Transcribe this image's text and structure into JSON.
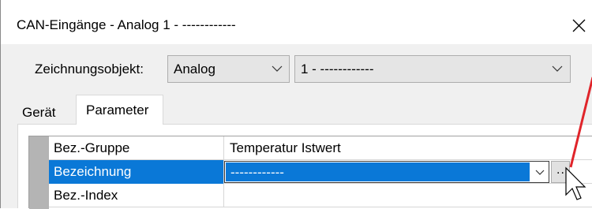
{
  "window": {
    "title": "CAN-Eingänge - Analog 1 - ------------",
    "close_glyph": "✕"
  },
  "drawing_object": {
    "label": "Zeichnungsobjekt:",
    "type_value": "Analog",
    "number_value": "1 - ------------"
  },
  "tabs": [
    {
      "label": "Gerät",
      "selected": false
    },
    {
      "label": "Parameter",
      "selected": true
    }
  ],
  "parameters": {
    "rows": [
      {
        "name": "Bez.-Gruppe",
        "value": "Temperatur Istwert"
      },
      {
        "name": "Bezeichnung",
        "value": "------------",
        "selected": true
      },
      {
        "name": "Bez.-Index",
        "value": ""
      }
    ],
    "ellipsis_label": "..."
  },
  "colors": {
    "selection": "#0a78d7",
    "annotation_arrow": "#e0242a"
  }
}
